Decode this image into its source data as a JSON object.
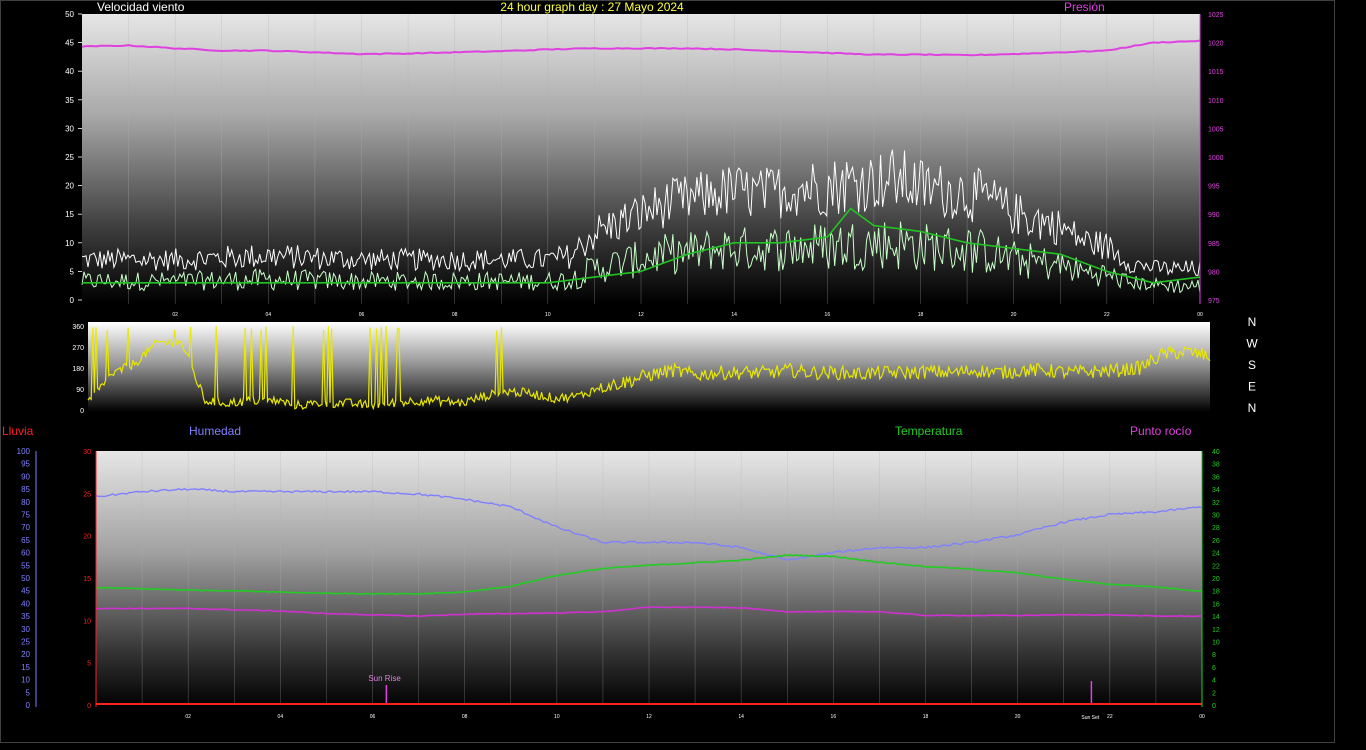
{
  "header": {
    "wind_title": "Velocidad viento",
    "graph_title": "24 hour graph day : 27 Mayo 2024",
    "pressure_title": "Presión"
  },
  "lower_header": {
    "rain_title": "Lluvia",
    "humidity_title": "Humedad",
    "temperature_title": "Temperatura",
    "dewpoint_title": "Punto rocío"
  },
  "compass": [
    "N",
    "W",
    "S",
    "E",
    "N"
  ],
  "colors": {
    "wind_gust": "#ffffff",
    "wind_avg": "#c8ffc8",
    "wind_avg_smooth": "#22c422",
    "pressure": "#e040e0",
    "direction": "#e8e800",
    "humidity": "#8080ff",
    "temperature": "#22cc22",
    "dewpoint": "#d030d0",
    "rain": "#ff2020",
    "title_yellow": "#ffff40",
    "grid": "#b0b0b0"
  },
  "time_ticks": [
    "02",
    "04",
    "06",
    "08",
    "10",
    "12",
    "14",
    "16",
    "18",
    "20",
    "22",
    "00"
  ],
  "annotations": {
    "sunrise": "Sun Rise",
    "sunset": "Sun Set"
  },
  "chart_data": [
    {
      "type": "line",
      "name": "wind",
      "x_range": [
        0,
        24
      ],
      "ylim": [
        0,
        50
      ],
      "yticks": [
        0,
        5,
        10,
        15,
        20,
        25,
        30,
        35,
        40,
        45,
        50
      ],
      "y2lim": [
        975,
        1025
      ],
      "y2ticks": [
        975,
        980,
        985,
        990,
        995,
        1000,
        1005,
        1010,
        1015,
        1020,
        1025
      ],
      "pressure_hpa": {
        "x": [
          0,
          1,
          2,
          3,
          4,
          5,
          6,
          7,
          8,
          9,
          10,
          11,
          12,
          13,
          14,
          15,
          16,
          17,
          18,
          19,
          20,
          21,
          22,
          23,
          24
        ],
        "values": [
          1019.3,
          1019.5,
          1019.0,
          1018.6,
          1018.6,
          1018.3,
          1018.0,
          1018.1,
          1018.3,
          1018.5,
          1018.8,
          1019.0,
          1019.0,
          1019.0,
          1018.8,
          1018.5,
          1018.2,
          1017.9,
          1017.9,
          1017.8,
          1018.0,
          1018.3,
          1018.6,
          1020.0,
          1020.3
        ]
      },
      "gust_envelope": {
        "x": [
          0,
          2,
          4,
          6,
          8,
          10,
          10.5,
          11,
          11.5,
          12,
          12.5,
          13,
          13.5,
          14,
          14.5,
          15,
          15.5,
          16,
          16.5,
          17,
          17.5,
          18,
          18.5,
          19,
          19.5,
          20,
          20.5,
          21,
          21.5,
          22,
          22.5,
          23,
          23.5,
          24
        ],
        "peak": [
          9,
          9,
          10,
          9,
          9,
          9,
          10,
          15,
          17,
          19,
          21,
          22,
          23,
          24,
          23,
          24,
          25,
          25,
          26,
          26,
          27,
          25,
          24,
          24,
          22,
          19,
          18,
          16,
          13,
          12,
          8,
          7,
          7,
          7
        ],
        "low": [
          3,
          3,
          3,
          3,
          3,
          3,
          3,
          5,
          6,
          7,
          8,
          8,
          9,
          9,
          9,
          9,
          9,
          9,
          9,
          10,
          9,
          9,
          9,
          8,
          8,
          7,
          6,
          6,
          5,
          4,
          3,
          3,
          2,
          2
        ]
      },
      "avg_smoothed": {
        "x": [
          0,
          1,
          2,
          3,
          4,
          5,
          6,
          7,
          8,
          9,
          10,
          11,
          12,
          13,
          14,
          15,
          16,
          16.5,
          17,
          18,
          19,
          20,
          21,
          22,
          23,
          24
        ],
        "values": [
          3,
          3,
          3,
          3,
          3,
          3,
          3,
          3,
          3,
          3,
          3,
          4,
          5,
          8,
          10,
          10,
          11,
          16,
          13,
          12,
          10,
          9,
          8,
          5,
          3,
          4
        ]
      }
    },
    {
      "type": "line",
      "name": "wind_direction",
      "x_range": [
        0,
        24
      ],
      "ylim": [
        0,
        360
      ],
      "yticks": [
        0,
        90,
        180,
        270,
        360
      ],
      "x": [
        0,
        0.5,
        1,
        1.5,
        2,
        2.5,
        3,
        3.5,
        4,
        4.5,
        5,
        5.5,
        6,
        6.5,
        7,
        7.5,
        8,
        8.5,
        9,
        9.5,
        10,
        10.5,
        11,
        11.5,
        12,
        12.5,
        13,
        13.5,
        14,
        14.5,
        15,
        15.5,
        16,
        16.5,
        17,
        17.5,
        18,
        18.5,
        19,
        19.5,
        20,
        20.5,
        21,
        21.5,
        22,
        22.5,
        23,
        23.5,
        24
      ],
      "values": [
        30,
        150,
        200,
        290,
        290,
        40,
        30,
        40,
        40,
        20,
        30,
        30,
        20,
        30,
        40,
        40,
        30,
        60,
        80,
        70,
        50,
        60,
        100,
        120,
        150,
        170,
        150,
        160,
        160,
        160,
        170,
        160,
        160,
        155,
        160,
        160,
        165,
        160,
        170,
        160,
        170,
        170,
        160,
        165,
        170,
        180,
        240,
        250,
        230
      ]
    },
    {
      "type": "line",
      "name": "climate",
      "x_range": [
        0,
        24
      ],
      "ylim_left": [
        0,
        30
      ],
      "yticks_left": [
        0,
        5,
        10,
        15,
        20,
        25,
        30
      ],
      "ylim_humidity": [
        0,
        100
      ],
      "yticks_humidity": [
        0,
        5,
        10,
        15,
        20,
        25,
        30,
        35,
        40,
        45,
        50,
        55,
        60,
        65,
        70,
        75,
        80,
        85,
        90,
        95,
        100
      ],
      "ylim_right": [
        0,
        40
      ],
      "yticks_right": [
        0,
        2,
        4,
        6,
        8,
        10,
        12,
        14,
        16,
        18,
        20,
        22,
        24,
        26,
        28,
        30,
        32,
        34,
        36,
        38,
        40
      ],
      "series": [
        {
          "name": "Humedad",
          "axis": "humidity",
          "x": [
            0,
            1,
            2,
            3,
            4,
            5,
            6,
            7,
            8,
            9,
            10,
            11,
            12,
            13,
            14,
            15,
            16,
            17,
            18,
            19,
            20,
            21,
            22,
            23,
            24
          ],
          "values": [
            82,
            84,
            85,
            84,
            84,
            84,
            84,
            83,
            81,
            78,
            70,
            64,
            64,
            64,
            62,
            57,
            60,
            62,
            62,
            64,
            67,
            72,
            75,
            76,
            78
          ]
        },
        {
          "name": "Temperatura",
          "axis": "right",
          "x": [
            0,
            1,
            2,
            3,
            4,
            5,
            6,
            7,
            8,
            9,
            10,
            11,
            12,
            13,
            14,
            15,
            16,
            17,
            18,
            19,
            20,
            21,
            22,
            23,
            24
          ],
          "values": [
            18.5,
            18.3,
            18.1,
            18.0,
            17.8,
            17.6,
            17.5,
            17.5,
            17.8,
            18.7,
            20.4,
            21.5,
            22.0,
            22.4,
            22.8,
            23.6,
            23.4,
            22.5,
            21.8,
            21.4,
            20.8,
            19.8,
            19.0,
            18.6,
            17.9
          ]
        },
        {
          "name": "Punto rocío",
          "axis": "right",
          "x": [
            0,
            1,
            2,
            3,
            4,
            5,
            6,
            7,
            8,
            9,
            10,
            11,
            12,
            13,
            14,
            15,
            16,
            17,
            18,
            19,
            20,
            21,
            22,
            23,
            24
          ],
          "values": [
            15.2,
            15.2,
            15.2,
            15.0,
            14.8,
            14.4,
            14.2,
            14.0,
            14.3,
            14.4,
            14.5,
            14.7,
            15.4,
            15.4,
            15.3,
            14.7,
            14.7,
            14.7,
            14.1,
            14.1,
            14.1,
            14.2,
            14.2,
            14.0,
            14.0
          ]
        },
        {
          "name": "Lluvia",
          "axis": "left",
          "x": [
            0,
            24
          ],
          "values": [
            0,
            0
          ]
        }
      ],
      "sunrise_hour": 6.3,
      "sunset_hour": 21.6
    }
  ]
}
